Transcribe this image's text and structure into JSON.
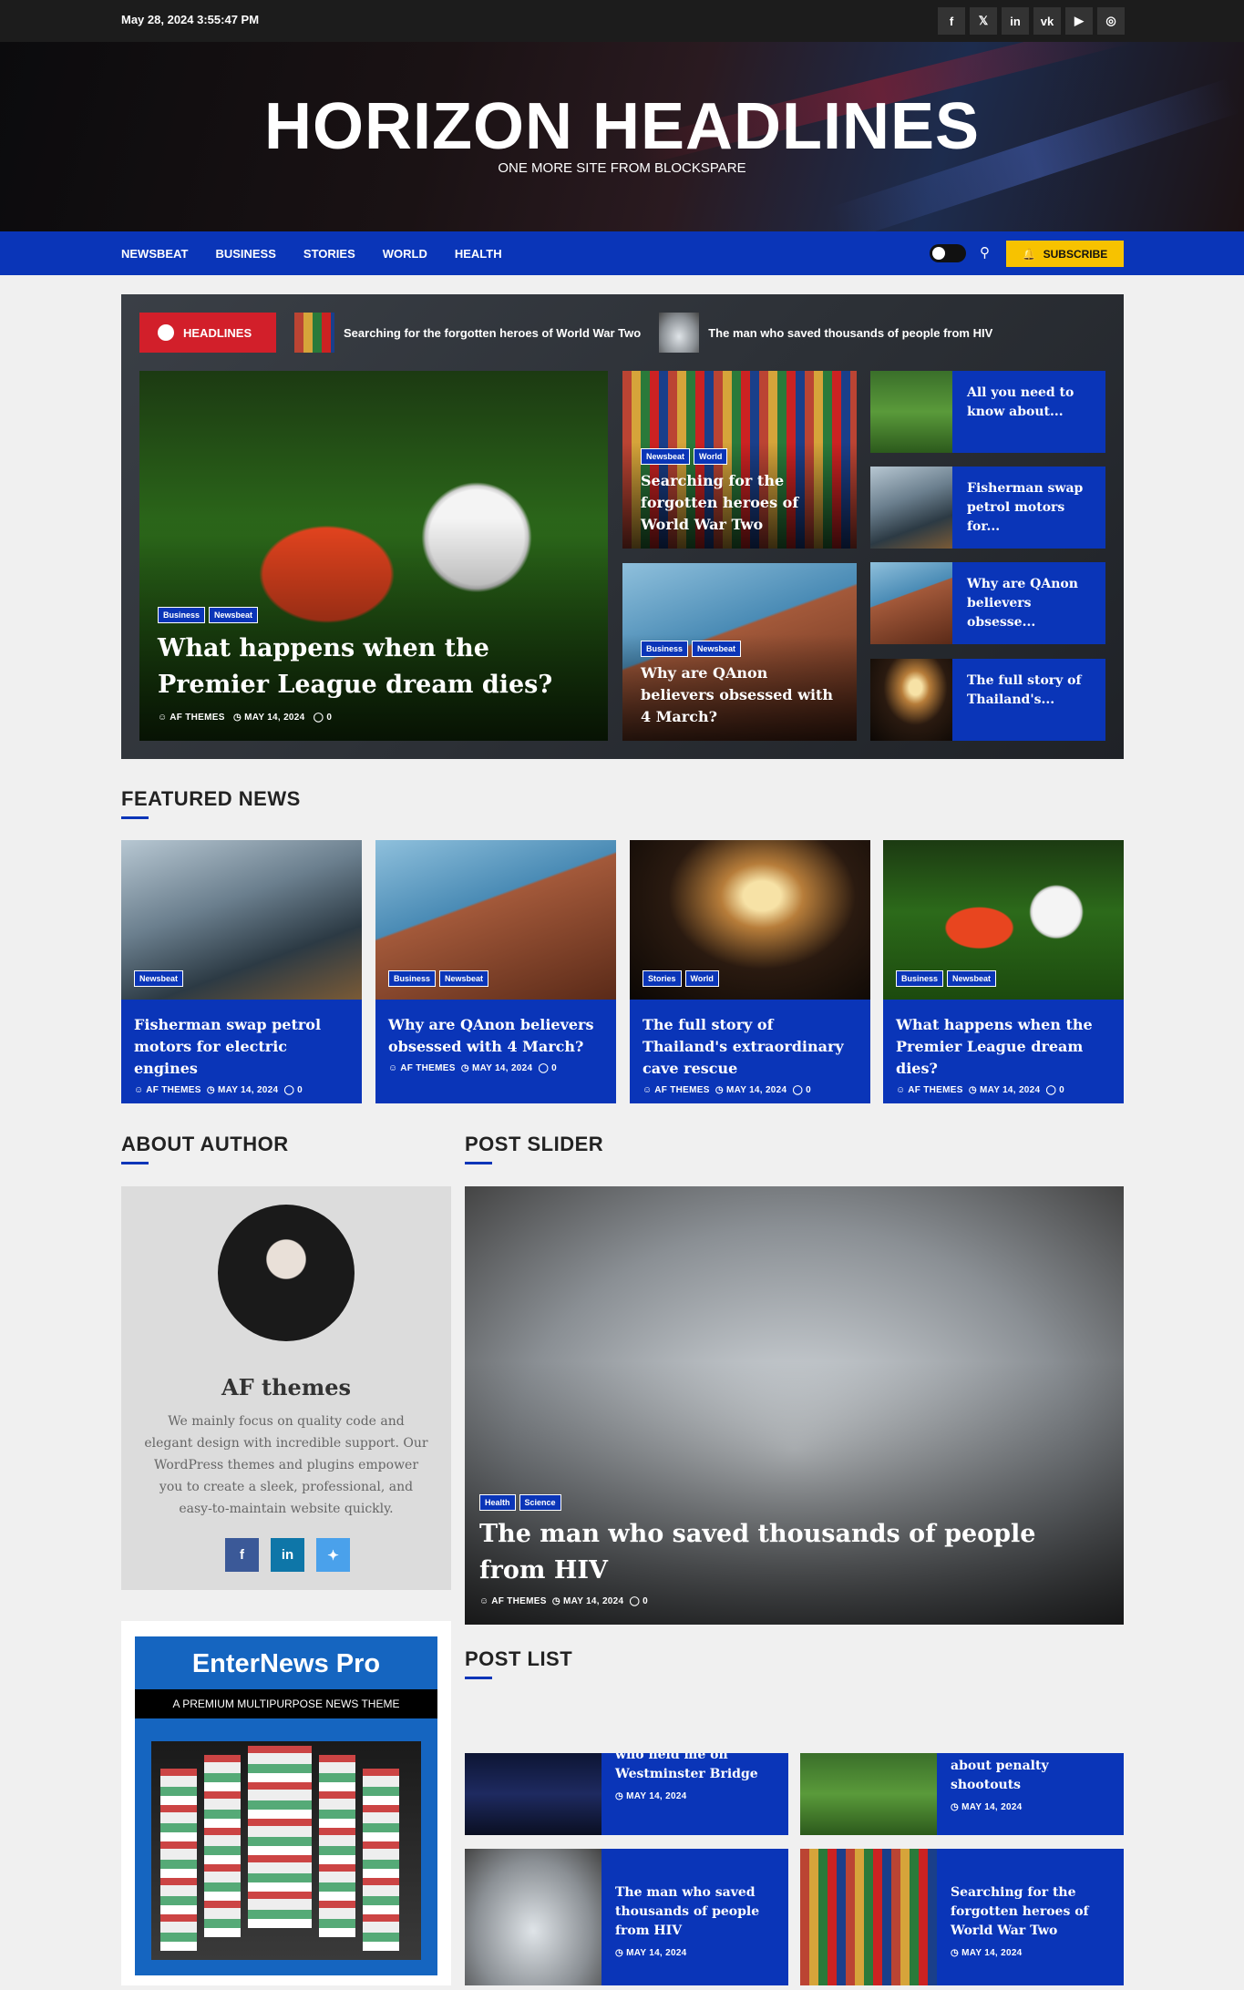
{
  "topbar": {
    "datetime": "May 28, 2024 3:55:47 PM",
    "social": [
      "f",
      "𝕏",
      "in",
      "vk",
      "▶",
      "◎"
    ]
  },
  "header": {
    "title": "HORIZON HEADLINES",
    "tagline": "ONE MORE SITE FROM BLOCKSPARE"
  },
  "nav": {
    "items": [
      "NEWSBEAT",
      "BUSINESS",
      "STORIES",
      "WORLD",
      "HEALTH"
    ],
    "subscribe": "SUBSCRIBE"
  },
  "ticker": {
    "label": "HEADLINES",
    "items": [
      "Searching for the forgotten heroes of World War Two",
      "The man who saved thousands of people from HIV"
    ]
  },
  "hero": {
    "main": {
      "cats": [
        "Business",
        "Newsbeat"
      ],
      "title": "What happens when the Premier League dream dies?",
      "author": "AF THEMES",
      "date": "MAY 14, 2024",
      "comments": "0"
    },
    "mid1": {
      "cats": [
        "Newsbeat",
        "World"
      ],
      "title": "Searching for the forgotten heroes of World War Two"
    },
    "mid2": {
      "cats": [
        "Business",
        "Newsbeat"
      ],
      "title": "Why are QAnon believers obsessed with 4 March?"
    },
    "small": [
      "All you need to know about...",
      "Fisherman swap petrol motors for...",
      "Why are QAnon believers obsesse...",
      "The full story of Thailand's..."
    ]
  },
  "featured": {
    "heading": "FEATURED NEWS",
    "items": [
      {
        "cats": [
          "Newsbeat"
        ],
        "title": "Fisherman swap petrol motors for electric engines",
        "author": "AF THEMES",
        "date": "MAY 14, 2024",
        "comments": "0"
      },
      {
        "cats": [
          "Business",
          "Newsbeat"
        ],
        "title": "Why are QAnon believers obsessed with 4 March?",
        "author": "AF THEMES",
        "date": "MAY 14, 2024",
        "comments": "0"
      },
      {
        "cats": [
          "Stories",
          "World"
        ],
        "title": "The full story of Thailand's extraordinary cave rescue",
        "author": "AF THEMES",
        "date": "MAY 14, 2024",
        "comments": "0"
      },
      {
        "cats": [
          "Business",
          "Newsbeat"
        ],
        "title": "What happens when the Premier League dream dies?",
        "author": "AF THEMES",
        "date": "MAY 14, 2024",
        "comments": "0"
      }
    ]
  },
  "author": {
    "heading": "ABOUT AUTHOR",
    "name": "AF themes",
    "bio": "We mainly focus on quality code and elegant design with incredible support. Our WordPress themes and plugins empower you to create a sleek, professional, and easy-to-maintain website quickly."
  },
  "promo": {
    "title": "EnterNews Pro",
    "subtitle": "A PREMIUM MULTIPURPOSE NEWS THEME"
  },
  "slider": {
    "heading": "POST SLIDER",
    "cats": [
      "Health",
      "Science"
    ],
    "title": "The man who saved thousands of people from HIV",
    "author": "AF THEMES",
    "date": "MAY 14, 2024",
    "comments": "0"
  },
  "postlist": {
    "heading": "POST LIST",
    "items": [
      {
        "title": "who held me on Westminster Bridge",
        "date": "MAY 14, 2024"
      },
      {
        "title": "about penalty shootouts",
        "date": "MAY 14, 2024"
      },
      {
        "title": "The man who saved thousands of people from HIV",
        "date": "MAY 14, 2024"
      },
      {
        "title": "Searching for the forgotten heroes of World War Two",
        "date": "MAY 14, 2024"
      }
    ]
  }
}
